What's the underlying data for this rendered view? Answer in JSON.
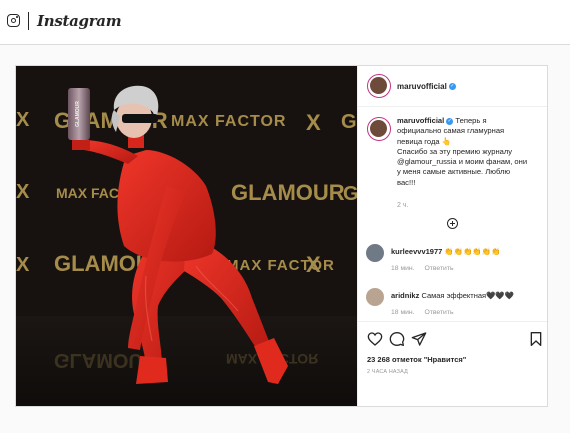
{
  "app": {
    "title": "Instagram"
  },
  "post": {
    "username": "maruvofficial",
    "verified": true,
    "photo": {
      "backdrop_brands": [
        "GLAMOUR",
        "MAX FACTOR",
        "X"
      ],
      "trophy_text": "GLAMOUR"
    },
    "caption": {
      "lines": [
        "Теперь я",
        "официально самая гламурная",
        "певица года 👆",
        "Спасибо за эту премию журналу",
        "@glamour_russia и моим фанам, они",
        "у меня самые активные. Люблю",
        "вас!!!"
      ],
      "time": "2 ч."
    },
    "comments": [
      {
        "username": "kurleevvv1977",
        "text": "👏👏👏👏👏👏",
        "time": "18 мин.",
        "reply": "Ответить"
      },
      {
        "username": "aridnikz",
        "text": "Самая эффектная🖤🖤🖤",
        "time": "18 мин.",
        "reply": "Ответить"
      }
    ],
    "likes": "23 268 отметок \"Нравится\"",
    "posted_ago": "2 ЧАСА НАЗАД",
    "icons": [
      "heart-icon",
      "comment-icon",
      "share-icon",
      "bookmark-icon",
      "add-comment-icon"
    ]
  },
  "colors": {
    "verified": "#3897f0",
    "suit": "#d7261c",
    "backdrop": "#15110f",
    "brand_gold": "#b59a52"
  }
}
